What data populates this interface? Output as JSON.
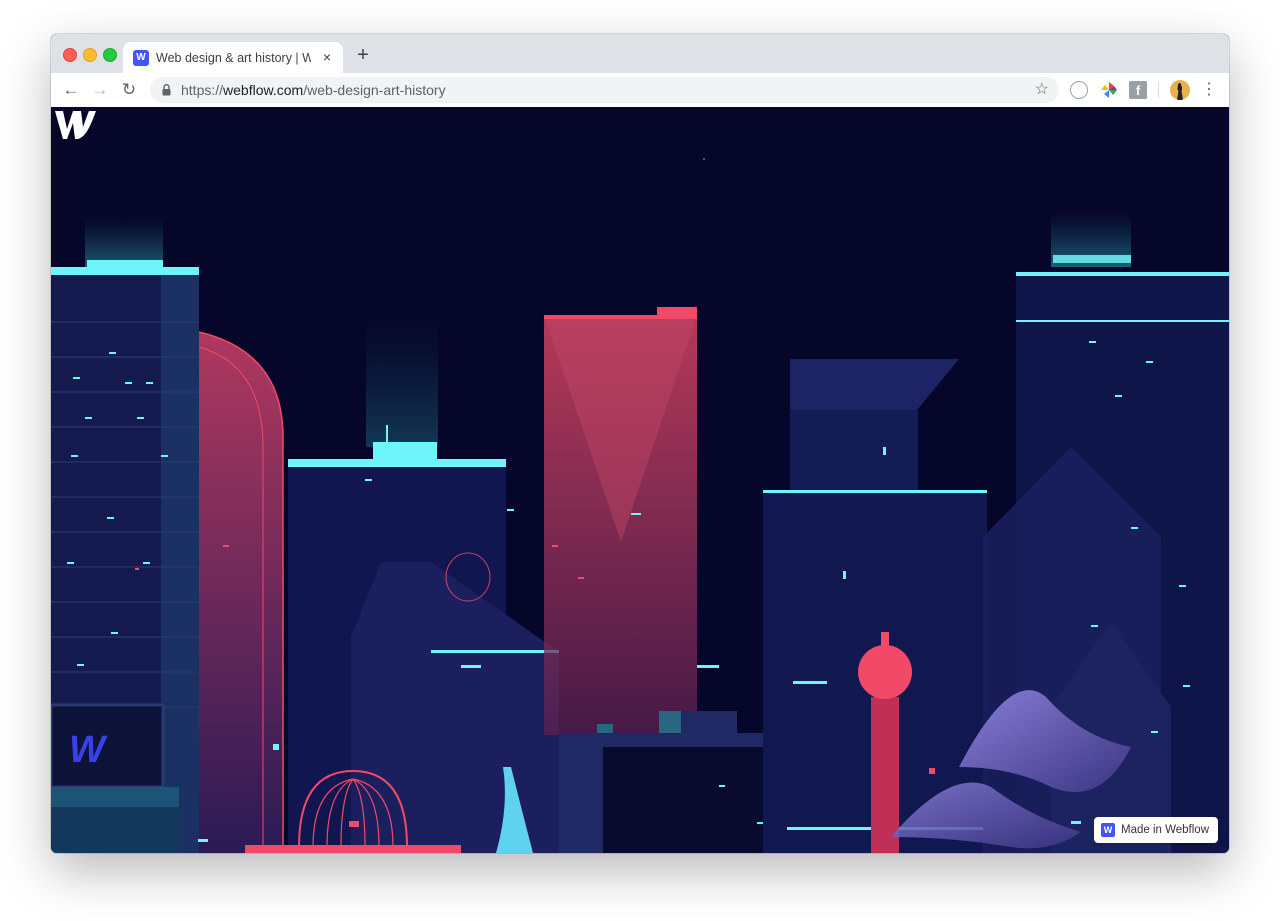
{
  "browser": {
    "tab": {
      "favicon_letter": "W",
      "title": "Web design & art history | Webflow",
      "close_symbol": "×"
    },
    "new_tab_symbol": "+",
    "nav": {
      "back_symbol": "←",
      "forward_symbol": "→",
      "reload_symbol": "↻"
    },
    "address": {
      "scheme": "https://",
      "host": "webflow.com",
      "path": "/web-design-art-history"
    },
    "bookmark_symbol": "☆",
    "extensions": [
      "globe-icon",
      "color-pinwheel-icon",
      "facebook-icon"
    ],
    "facebook_letter": "f",
    "menu_symbol": "⋮"
  },
  "page": {
    "badge": {
      "icon_letter": "W",
      "label": "Made in Webflow"
    },
    "colors": {
      "background": "#06062a",
      "cyan": "#6ef5fa",
      "pink": "#f04a68",
      "brand_blue": "#4353ff"
    }
  }
}
